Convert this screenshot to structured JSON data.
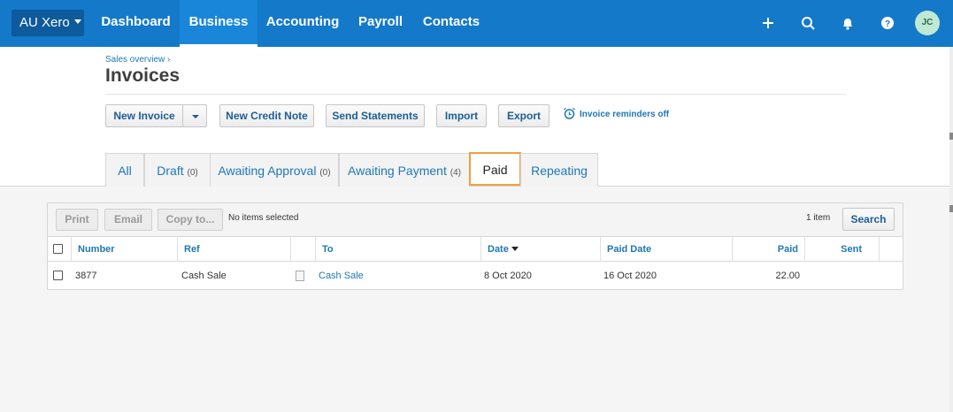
{
  "nav": {
    "org": "AU Xero",
    "items": [
      "Dashboard",
      "Business",
      "Accounting",
      "Payroll",
      "Contacts"
    ],
    "active": "Business",
    "avatar": "JC"
  },
  "header": {
    "breadcrumb": "Sales overview ›",
    "title": "Invoices"
  },
  "actions": {
    "new_invoice": "New Invoice",
    "new_credit_note": "New Credit Note",
    "send_statements": "Send Statements",
    "import": "Import",
    "export": "Export",
    "reminders": "Invoice reminders off"
  },
  "tabs": [
    {
      "label": "All",
      "count": ""
    },
    {
      "label": "Draft",
      "count": "(0)"
    },
    {
      "label": "Awaiting Approval",
      "count": "(0)"
    },
    {
      "label": "Awaiting Payment",
      "count": "(4)"
    },
    {
      "label": "Paid",
      "count": ""
    },
    {
      "label": "Repeating",
      "count": ""
    }
  ],
  "toolbar": {
    "print": "Print",
    "email": "Email",
    "copy": "Copy to...",
    "selection": "No items selected",
    "count": "1 item",
    "search": "Search"
  },
  "table": {
    "headers": [
      "Number",
      "Ref",
      "To",
      "Date",
      "Paid Date",
      "Paid",
      "Sent"
    ],
    "rows": [
      {
        "number": "3877",
        "ref": "Cash Sale",
        "to": "Cash Sale",
        "date": "8 Oct 2020",
        "paid_date": "16 Oct 2020",
        "paid": "22.00",
        "sent": ""
      }
    ]
  },
  "colors": {
    "nav_bg": "#1479c9",
    "link": "#1e77b6",
    "active_tab_outline": "#f0a040"
  }
}
